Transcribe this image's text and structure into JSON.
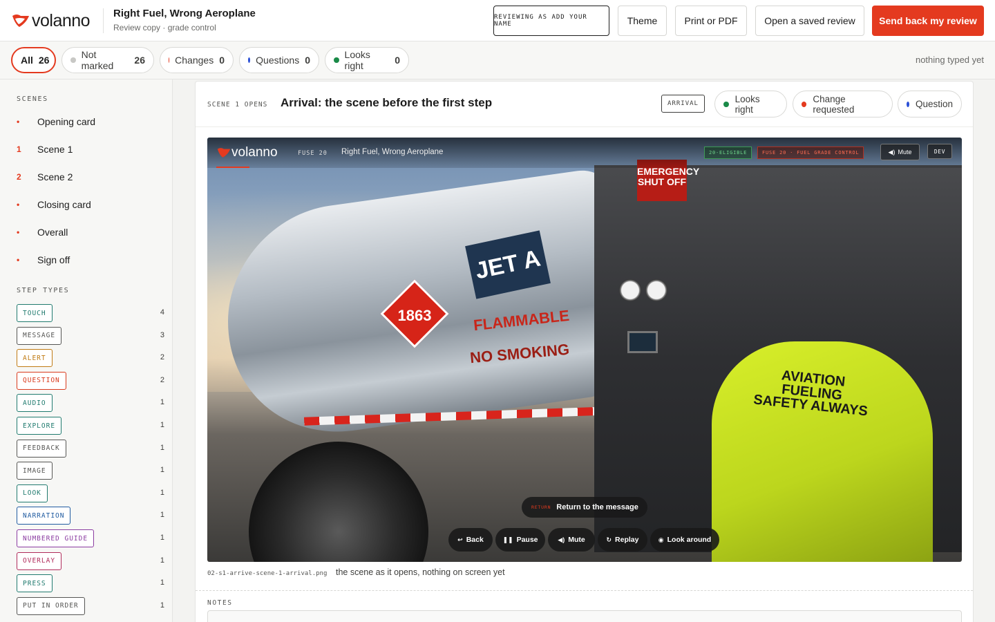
{
  "header": {
    "logo_text": "volanno",
    "title": "Right Fuel, Wrong Aeroplane",
    "subtitle": "Review copy · grade control",
    "buttons": {
      "name": "REVIEWING AS ADD YOUR NAME",
      "theme": "Theme",
      "print": "Print or PDF",
      "open": "Open a saved review",
      "send": "Send back my review"
    },
    "accent_color": "#e43a1f"
  },
  "filters": {
    "all": {
      "label": "All",
      "count": "26"
    },
    "not_marked": {
      "label": "Not marked",
      "count": "26"
    },
    "changes": {
      "label": "Changes",
      "count": "0"
    },
    "questions": {
      "label": "Questions",
      "count": "0"
    },
    "looks_right": {
      "label": "Looks right",
      "count": "0"
    },
    "typed_status": "nothing typed yet"
  },
  "sidebar": {
    "scenes_label": "SCENES",
    "scenes": [
      {
        "marker": "•",
        "label": "Opening card"
      },
      {
        "marker": "1",
        "label": "Scene 1"
      },
      {
        "marker": "2",
        "label": "Scene 2"
      },
      {
        "marker": "•",
        "label": "Closing card"
      },
      {
        "marker": "•",
        "label": "Overall"
      },
      {
        "marker": "•",
        "label": "Sign off"
      }
    ],
    "step_types_label": "STEP TYPES",
    "step_types": [
      {
        "label": "TOUCH",
        "count": "4",
        "color": "#1f7a6e"
      },
      {
        "label": "MESSAGE",
        "count": "3",
        "color": "#555553"
      },
      {
        "label": "ALERT",
        "count": "2",
        "color": "#c07a12"
      },
      {
        "label": "QUESTION",
        "count": "2",
        "color": "#d9391c"
      },
      {
        "label": "AUDIO",
        "count": "1",
        "color": "#1f7a6e"
      },
      {
        "label": "EXPLORE",
        "count": "1",
        "color": "#1f7a6e"
      },
      {
        "label": "FEEDBACK",
        "count": "1",
        "color": "#555553"
      },
      {
        "label": "IMAGE",
        "count": "1",
        "color": "#555553"
      },
      {
        "label": "LOOK",
        "count": "1",
        "color": "#1f7a6e"
      },
      {
        "label": "NARRATION",
        "count": "1",
        "color": "#1f5aa0"
      },
      {
        "label": "NUMBERED GUIDE",
        "count": "1",
        "color": "#8a3aa0"
      },
      {
        "label": "OVERLAY",
        "count": "1",
        "color": "#b02a5a"
      },
      {
        "label": "PRESS",
        "count": "1",
        "color": "#1f7a6e"
      },
      {
        "label": "PUT IN ORDER",
        "count": "1",
        "color": "#555553"
      }
    ]
  },
  "card": {
    "scene_opens": "SCENE 1 OPENS",
    "title": "Arrival: the scene before the first step",
    "tag": "ARRIVAL",
    "review_pills": {
      "looks_right": "Looks right",
      "change_requested": "Change requested",
      "question": "Question"
    },
    "dot_colors": {
      "green": "#1a8a48",
      "red": "#e43a1f",
      "blue": "#2a4fd6",
      "grey": "#c8c8c5"
    },
    "image": {
      "logo_text": "volanno",
      "fuse": "FUSE 20",
      "title": "Right Fuel, Wrong Aeroplane",
      "eligible": "20-ELIGIBLE",
      "fgc": "FUSE 20 · FUEL GRADE CONTROL",
      "mute_top": "Mute",
      "dev": "DEV",
      "emergency": "EMERGENCY SHUT OFF",
      "jet": "JET A",
      "diamond_top": "3",
      "diamond_num": "1863",
      "flammable": "FLAMMABLE",
      "no_smoking": "NO SMOKING",
      "vest": "AVIATION FUELING SAFETY ALWAYS",
      "return_kicker": "RETURN",
      "return_label": "Return to the message",
      "controls": [
        {
          "icon": "↩",
          "label": "Back"
        },
        {
          "icon": "❚❚",
          "label": "Pause"
        },
        {
          "icon": "◀)",
          "label": "Mute"
        },
        {
          "icon": "↻",
          "label": "Replay"
        },
        {
          "icon": "◉",
          "label": "Look around"
        }
      ]
    },
    "caption_file": "02-s1-arrive-scene-1-arrival.png",
    "caption_text": "the scene as it opens, nothing on screen yet",
    "notes_label": "NOTES"
  }
}
